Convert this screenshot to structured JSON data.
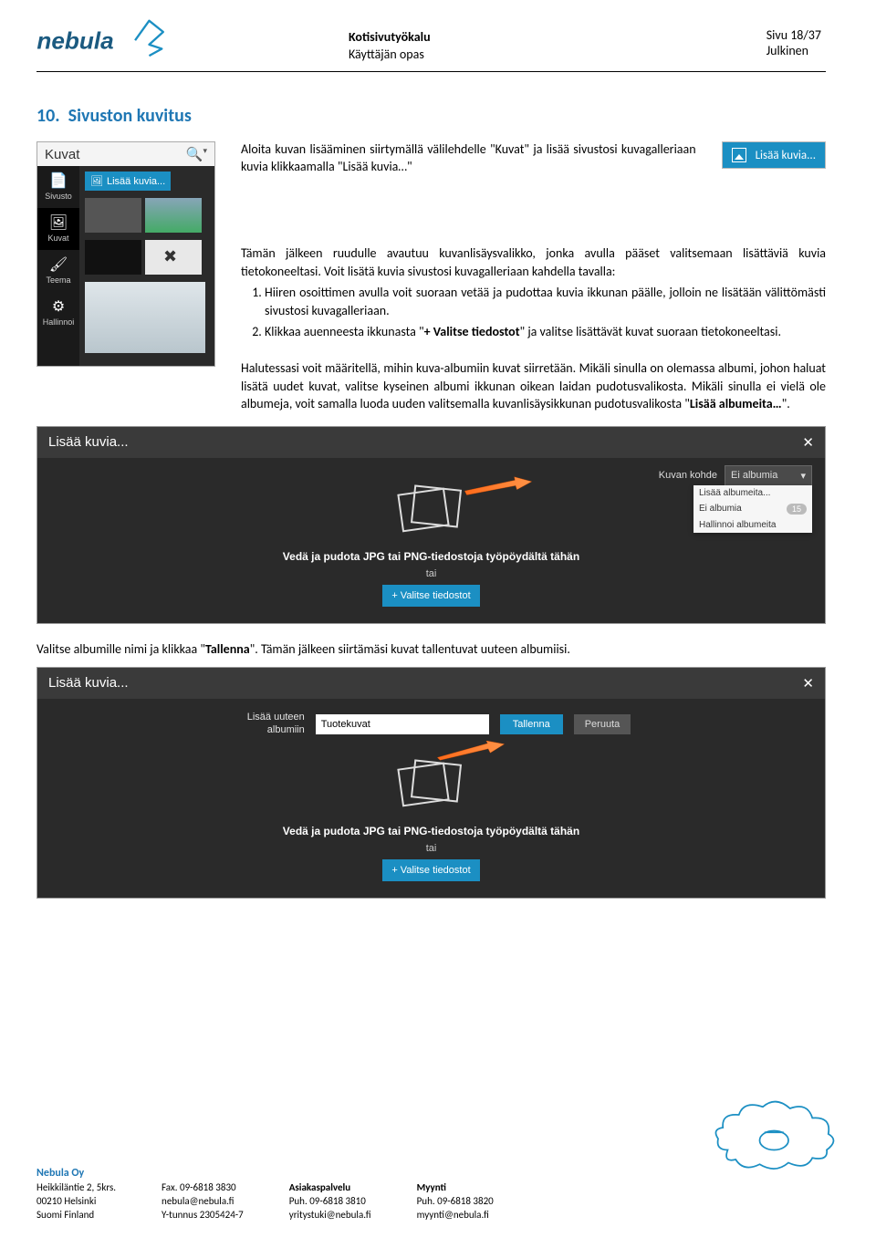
{
  "header": {
    "doc_title": "Kotisivutyökalu",
    "doc_subtitle": "Käyttäjän opas",
    "page_info": "Sivu 18/37",
    "classification": "Julkinen"
  },
  "section": {
    "number": "10.",
    "title": "Sivuston kuvitus",
    "intro": "Aloita kuvan lisääminen siirtymällä välilehdelle \"Kuvat\" ja lisää sivustosi kuvagalleriaan kuvia klikkaamalla \"Lisää kuvia…\"",
    "para2_lead": "Tämän jälkeen ruudulle avautuu kuvanlisäysvalikko, jonka avulla pääset valitsemaan lisättäviä kuvia tietokoneeltasi. Voit lisätä kuvia sivustosi kuvagalleriaan kahdella tavalla:",
    "steps": [
      "Hiiren osoittimen avulla voit suoraan vetää ja pudottaa kuvia ikkunan päälle, jolloin ne lisätään välittömästi sivustosi kuvagalleriaan.",
      "Klikkaa auenneesta ikkunasta \"+ Valitse tiedostot\" ja valitse lisättävät kuvat suoraan tietokoneeltasi."
    ],
    "para3": "Halutessasi voit määritellä, mihin kuva-albumiin kuvat siirretään. Mikäli sinulla on olemassa albumi, johon haluat lisätä uudet kuvat, valitse kyseinen albumi ikkunan oikean laidan pudotusvalikosta. Mikäli sinulla ei vielä ole albumeja, voit samalla luoda uuden valitsemalla kuvanlisäysikkunan pudotusvalikosta \"Lisää albumeita…\".",
    "para4": "Valitse albumille nimi ja klikkaa \"Tallenna\". Tämän jälkeen siirtämäsi kuvat tallentuvat uuteen albumiisi."
  },
  "sidebar_shot": {
    "title": "Kuvat",
    "nav": [
      {
        "label": "Sivusto"
      },
      {
        "label": "Kuvat"
      },
      {
        "label": "Teema"
      },
      {
        "label": "Hallinnoi"
      }
    ],
    "add_btn": "Lisää kuvia..."
  },
  "hint_button": {
    "label": "Lisää kuvia..."
  },
  "dialog1": {
    "title": "Lisää kuvia...",
    "kohde_label": "Kuvan kohde",
    "kohde_value": "Ei albumia",
    "dropdown": [
      {
        "label": "Lisää albumeita..."
      },
      {
        "label": "Ei albumia",
        "count": "15"
      },
      {
        "label": "Hallinnoi albumeita"
      }
    ],
    "drop_text": "Vedä ja pudota JPG tai PNG-tiedostoja työpöydältä tähän",
    "tai": "tai",
    "select_btn": "+ Valitse tiedostot"
  },
  "dialog2": {
    "title": "Lisää kuvia...",
    "new_album_label": "Lisää uuteen albumiin",
    "input_value": "Tuotekuvat",
    "save": "Tallenna",
    "cancel": "Peruuta",
    "drop_text": "Vedä ja pudota JPG tai PNG-tiedostoja työpöydältä tähän",
    "tai": "tai",
    "select_btn": "+ Valitse tiedostot"
  },
  "footer": {
    "brand": "Nebula Oy",
    "col1": [
      "Heikkiläntie 2, 5krs.",
      "00210 Helsinki",
      "Suomi Finland"
    ],
    "col2": [
      "Fax. 09-6818 3830",
      "nebula@nebula.fi",
      "Y-tunnus 2305424-7"
    ],
    "col3_h": "Asiakaspalvelu",
    "col3": [
      "Puh. 09-6818 3810",
      "yritystuki@nebula.fi"
    ],
    "col4_h": "Myynti",
    "col4": [
      "Puh. 09-6818 3820",
      "myynti@nebula.fi"
    ]
  }
}
